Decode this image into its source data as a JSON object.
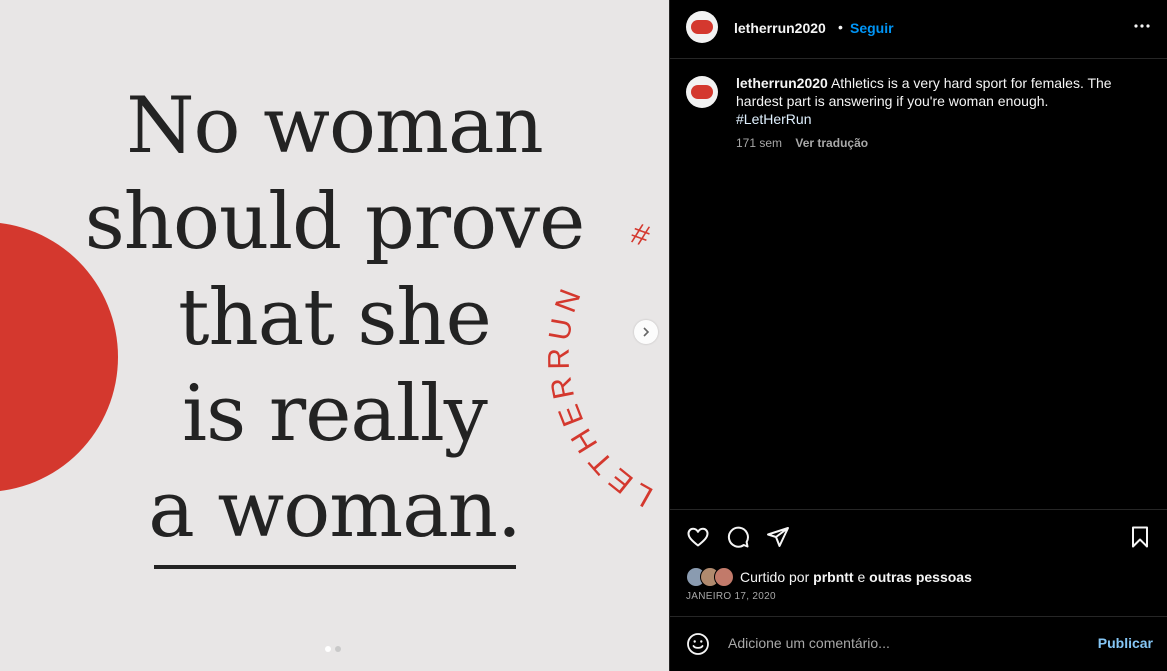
{
  "colors": {
    "accent_red": "#d4382e",
    "link_blue": "#0095f6"
  },
  "media": {
    "quote_lines": [
      "No woman",
      "should prove",
      "that she",
      "is really",
      "a woman."
    ],
    "arc_text": "LETHERRUN",
    "arc_hash": "#",
    "next_icon": "chevron-right-icon",
    "dots": [
      true,
      false
    ]
  },
  "header": {
    "username": "letherrun2020",
    "separator": "•",
    "follow_label": "Seguir",
    "more_icon": "more-horizontal-icon"
  },
  "caption": {
    "username": "letherrun2020",
    "text": "Athletics is a very hard sport for females. The hardest part is answering if you're woman enough.",
    "hashtag": "#LetHerRun",
    "age": "171 sem",
    "translate_label": "Ver tradução"
  },
  "actions": {
    "icons": [
      "heart-icon",
      "comment-icon",
      "share-icon",
      "bookmark-icon"
    ],
    "liked_by_prefix": "Curtido por",
    "liked_by_user": "prbntt",
    "liked_by_joiner": "e",
    "liked_by_others": "outras pessoas",
    "date": "JANEIRO 17, 2020"
  },
  "comment": {
    "placeholder": "Adicione um comentário...",
    "publish_label": "Publicar"
  }
}
